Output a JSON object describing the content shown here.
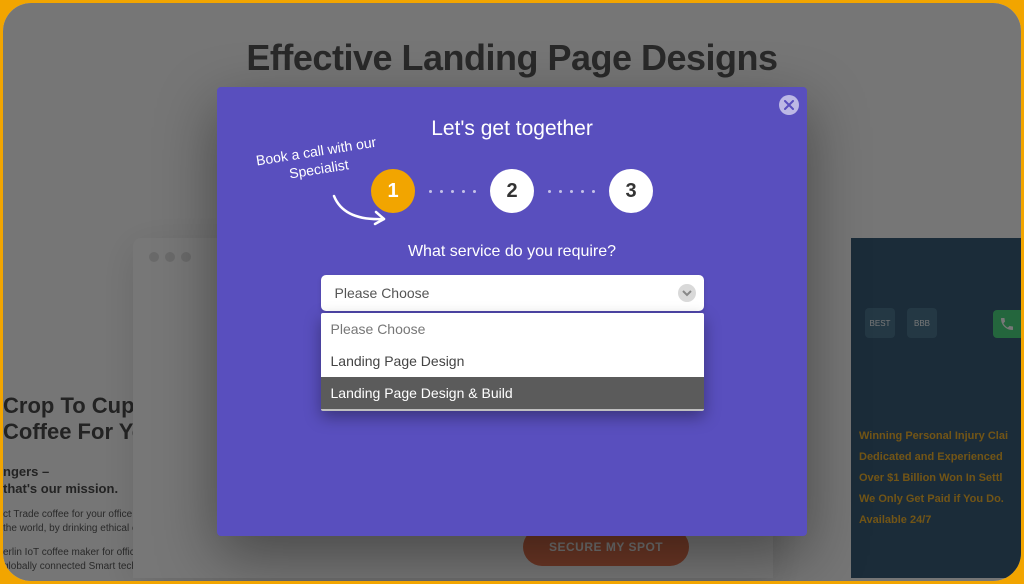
{
  "background": {
    "page_title": "Effective Landing Page Designs",
    "left_card": {
      "line1": "Crop To Cup,",
      "line2": "Coffee For Yo",
      "sub1": "ngers –",
      "sub2": "that's our mission.",
      "tiny1": "ct Trade coffee for your office. S",
      "tiny2": "the world, by drinking ethical c",
      "tiny3": "erlin IoT coffee maker for offices",
      "tiny4": "globally connected Smart tech"
    },
    "cta_button": "SECURE MY SPOT",
    "right_card": {
      "badges": [
        "BEST",
        "BBB"
      ],
      "bullets": [
        "Winning Personal Injury Clai",
        "Dedicated and Experienced",
        "Over $1 Billion Won In Settl",
        "We Only Get Paid if You Do.",
        "Available 24/7"
      ]
    }
  },
  "modal": {
    "title": "Let's get together",
    "callout": "Book a call with our Specialist",
    "steps": [
      "1",
      "2",
      "3"
    ],
    "active_step_index": 0,
    "question": "What service do you require?",
    "select": {
      "value": "Please Choose",
      "options": [
        {
          "label": "Please Choose",
          "state": "placeholder"
        },
        {
          "label": "Landing Page Design",
          "state": "normal"
        },
        {
          "label": "Landing Page Design & Build",
          "state": "highlight"
        }
      ]
    }
  },
  "colors": {
    "accent": "#f2a500",
    "modal_bg": "#594fbe",
    "cta": "#e85b2b"
  }
}
